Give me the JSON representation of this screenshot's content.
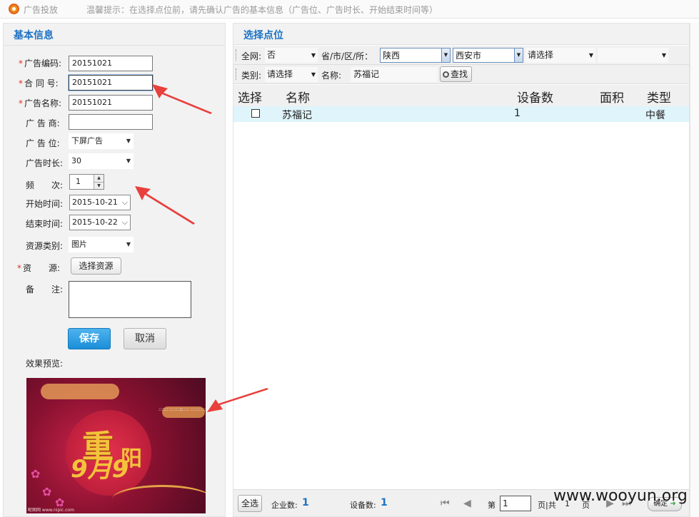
{
  "app": {
    "title": "广告投放",
    "hint": "温馨提示：在选择点位前，请先确认广告的基本信息（广告位、广告时长、开始结束时间等）"
  },
  "left": {
    "title": "基本信息",
    "fields": {
      "code_label": "广告编码:",
      "code_value": "20151021",
      "contract_label": "合 同 号:",
      "contract_value": "20151021",
      "name_label": "广告名称:",
      "name_value": "20151021",
      "advertiser_label": "广 告 商:",
      "advertiser_value": "",
      "slot_label": "广 告 位:",
      "slot_value": "下屏广告",
      "duration_label": "广告时长:",
      "duration_value": "30",
      "frequency_label": "频　　次:",
      "frequency_value": "1",
      "start_label": "开始时间:",
      "start_value": "2015-10-21",
      "end_label": "结束时间:",
      "end_value": "2015-10-22",
      "resource_type_label": "资源类别:",
      "resource_type_value": "图片",
      "resource_label": "资　　源:",
      "resource_button": "选择资源",
      "remark_label": "备　　注:"
    },
    "save_button": "保存",
    "cancel_button": "取消",
    "preview_label": "效果预览:",
    "preview_text": {
      "glyph_1": "重",
      "glyph_2": "阳",
      "digits": "9月9",
      "caption": "昵图网 www.nipic.com"
    }
  },
  "right": {
    "title": "选择点位",
    "filters": {
      "network_label": "全网:",
      "network_value": "否",
      "region_label": "省/市/区/所：",
      "province_value": "陕西",
      "city_value": "西安市",
      "district_value": "请选择",
      "station_value": "",
      "category_label": "类别:",
      "category_value": "请选择",
      "name_label": "名称:",
      "name_value": "苏福记",
      "search_button": "查找"
    },
    "columns": [
      "选择",
      "名称",
      "设备数",
      "面积",
      "类型"
    ],
    "rows": [
      {
        "name": "苏福记",
        "devices": "1",
        "area": "",
        "type": "中餐"
      }
    ],
    "footer": {
      "select_all": "全选",
      "company_count_label": "企业数:",
      "company_count": "1",
      "device_count_label": "设备数:",
      "device_count": "1",
      "page_prefix": "第",
      "page_value": "1",
      "page_mid": "页|共",
      "page_total": "1",
      "page_suffix": "页",
      "ok_button": "确定"
    }
  },
  "watermark": "www.wooyun.org",
  "colors": {
    "accent": "#1d72c3",
    "required": "#e03030",
    "row_highlight": "#dff4fb",
    "arrow": "#e8403c"
  }
}
